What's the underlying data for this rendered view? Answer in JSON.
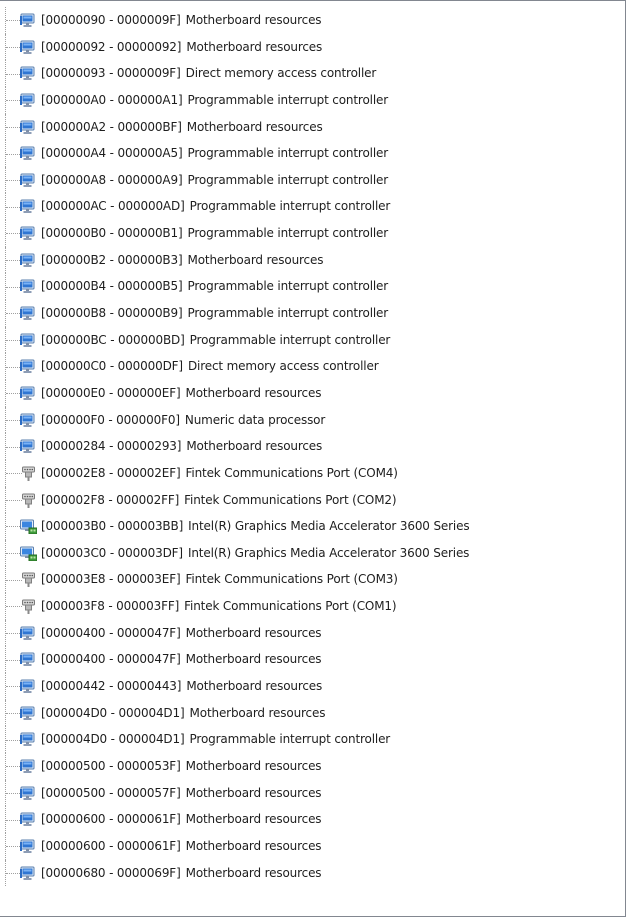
{
  "rows": [
    {
      "range": "[00000090 - 0000009F]",
      "name": "Motherboard resources",
      "icon": "system-device-icon"
    },
    {
      "range": "[00000092 - 00000092]",
      "name": "Motherboard resources",
      "icon": "system-device-icon"
    },
    {
      "range": "[00000093 - 0000009F]",
      "name": "Direct memory access controller",
      "icon": "system-device-icon"
    },
    {
      "range": "[000000A0 - 000000A1]",
      "name": "Programmable interrupt controller",
      "icon": "system-device-icon"
    },
    {
      "range": "[000000A2 - 000000BF]",
      "name": "Motherboard resources",
      "icon": "system-device-icon"
    },
    {
      "range": "[000000A4 - 000000A5]",
      "name": "Programmable interrupt controller",
      "icon": "system-device-icon"
    },
    {
      "range": "[000000A8 - 000000A9]",
      "name": "Programmable interrupt controller",
      "icon": "system-device-icon"
    },
    {
      "range": "[000000AC - 000000AD]",
      "name": "Programmable interrupt controller",
      "icon": "system-device-icon"
    },
    {
      "range": "[000000B0 - 000000B1]",
      "name": "Programmable interrupt controller",
      "icon": "system-device-icon"
    },
    {
      "range": "[000000B2 - 000000B3]",
      "name": "Motherboard resources",
      "icon": "system-device-icon"
    },
    {
      "range": "[000000B4 - 000000B5]",
      "name": "Programmable interrupt controller",
      "icon": "system-device-icon"
    },
    {
      "range": "[000000B8 - 000000B9]",
      "name": "Programmable interrupt controller",
      "icon": "system-device-icon"
    },
    {
      "range": "[000000BC - 000000BD]",
      "name": "Programmable interrupt controller",
      "icon": "system-device-icon"
    },
    {
      "range": "[000000C0 - 000000DF]",
      "name": "Direct memory access controller",
      "icon": "system-device-icon"
    },
    {
      "range": "[000000E0 - 000000EF]",
      "name": "Motherboard resources",
      "icon": "system-device-icon"
    },
    {
      "range": "[000000F0 - 000000F0]",
      "name": "Numeric data processor",
      "icon": "system-device-icon"
    },
    {
      "range": "[00000284 - 00000293]",
      "name": "Motherboard resources",
      "icon": "system-device-icon"
    },
    {
      "range": "[000002E8 - 000002EF]",
      "name": "Fintek Communications Port (COM4)",
      "icon": "com-port-icon"
    },
    {
      "range": "[000002F8 - 000002FF]",
      "name": "Fintek Communications Port (COM2)",
      "icon": "com-port-icon"
    },
    {
      "range": "[000003B0 - 000003BB]",
      "name": "Intel(R) Graphics Media Accelerator 3600 Series",
      "icon": "display-adapter-icon"
    },
    {
      "range": "[000003C0 - 000003DF]",
      "name": "Intel(R) Graphics Media Accelerator 3600 Series",
      "icon": "display-adapter-icon"
    },
    {
      "range": "[000003E8 - 000003EF]",
      "name": "Fintek Communications Port (COM3)",
      "icon": "com-port-icon"
    },
    {
      "range": "[000003F8 - 000003FF]",
      "name": "Fintek Communications Port (COM1)",
      "icon": "com-port-icon"
    },
    {
      "range": "[00000400 - 0000047F]",
      "name": "Motherboard resources",
      "icon": "system-device-icon"
    },
    {
      "range": "[00000400 - 0000047F]",
      "name": "Motherboard resources",
      "icon": "system-device-icon"
    },
    {
      "range": "[00000442 - 00000443]",
      "name": "Motherboard resources",
      "icon": "system-device-icon"
    },
    {
      "range": "[000004D0 - 000004D1]",
      "name": "Motherboard resources",
      "icon": "system-device-icon"
    },
    {
      "range": "[000004D0 - 000004D1]",
      "name": "Programmable interrupt controller",
      "icon": "system-device-icon"
    },
    {
      "range": "[00000500 - 0000053F]",
      "name": "Motherboard resources",
      "icon": "system-device-icon"
    },
    {
      "range": "[00000500 - 0000057F]",
      "name": "Motherboard resources",
      "icon": "system-device-icon"
    },
    {
      "range": "[00000600 - 0000061F]",
      "name": "Motherboard resources",
      "icon": "system-device-icon"
    },
    {
      "range": "[00000600 - 0000061F]",
      "name": "Motherboard resources",
      "icon": "system-device-icon"
    },
    {
      "range": "[00000680 - 0000069F]",
      "name": "Motherboard resources",
      "icon": "system-device-icon"
    }
  ]
}
